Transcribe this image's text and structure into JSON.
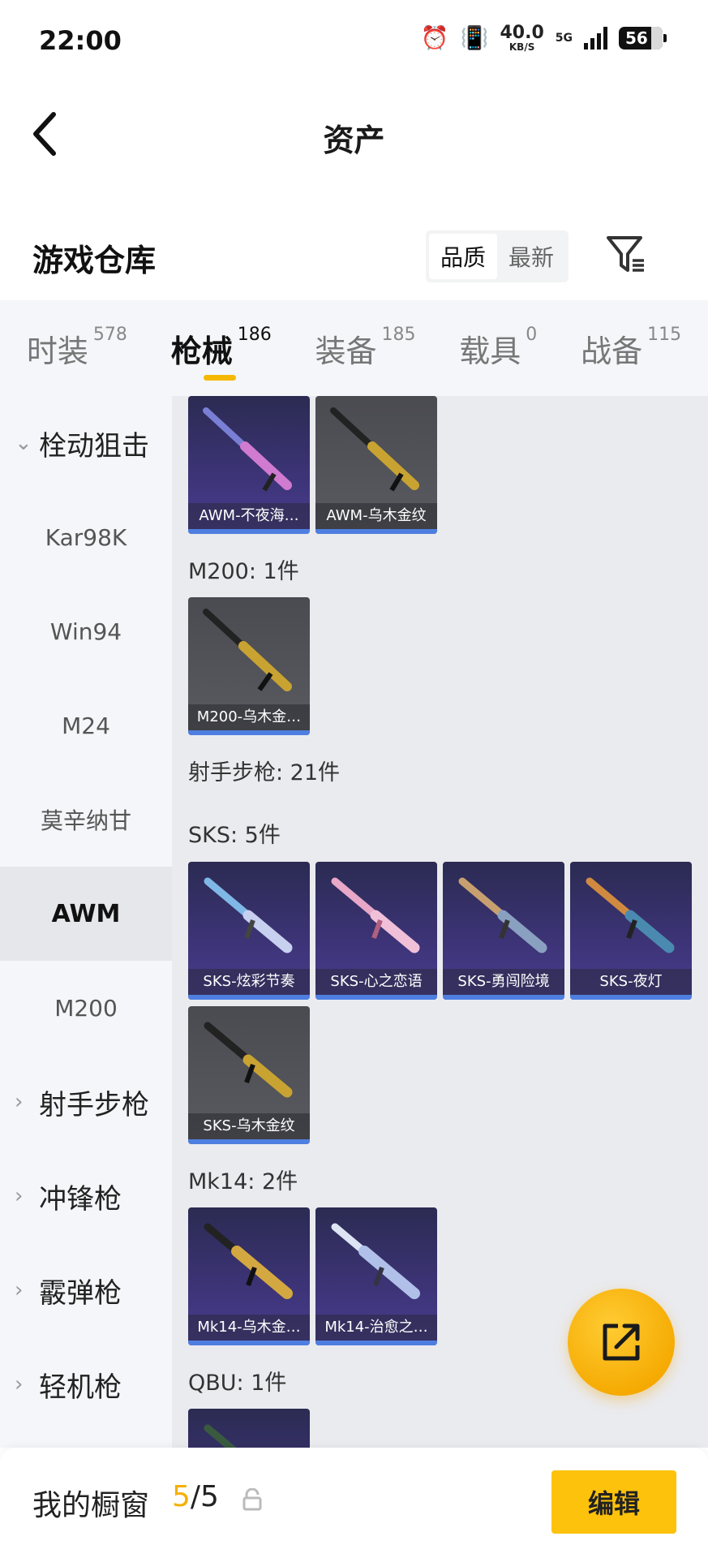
{
  "status_bar": {
    "time": "22:00",
    "speed_value": "40.0",
    "speed_unit": "KB/S",
    "network": "5G",
    "battery": "56"
  },
  "header": {
    "title": "资产",
    "back_icon": "chevron-left-icon"
  },
  "warehouse": {
    "title": "游戏仓库",
    "sort_options": [
      "品质",
      "最新"
    ],
    "active_sort": "品质",
    "filter_icon": "filter-icon"
  },
  "tabs": [
    {
      "label": "时装",
      "count": "578"
    },
    {
      "label": "枪械",
      "count": "186",
      "active": true
    },
    {
      "label": "装备",
      "count": "185"
    },
    {
      "label": "载具",
      "count": "0"
    },
    {
      "label": "战备",
      "count": "115"
    }
  ],
  "sidebar": {
    "items": [
      {
        "label": "栓动狙击",
        "type": "group",
        "expanded": true
      },
      {
        "label": "Kar98K",
        "type": "sub"
      },
      {
        "label": "Win94",
        "type": "sub"
      },
      {
        "label": "M24",
        "type": "sub"
      },
      {
        "label": "莫辛纳甘",
        "type": "sub"
      },
      {
        "label": "AWM",
        "type": "sub",
        "active": true
      },
      {
        "label": "M200",
        "type": "sub"
      },
      {
        "label": "射手步枪",
        "type": "group"
      },
      {
        "label": "冲锋枪",
        "type": "group"
      },
      {
        "label": "霰弹枪",
        "type": "group"
      },
      {
        "label": "轻机枪",
        "type": "group"
      }
    ]
  },
  "content": {
    "sections": [
      {
        "label": ""
      },
      {
        "label": "M200: 1件"
      },
      {
        "label": "射手步枪: 21件"
      },
      {
        "label": "SKS: 5件"
      },
      {
        "label": "Mk14: 2件"
      },
      {
        "label": "QBU: 1件"
      }
    ],
    "items": [
      {
        "name": "AWM-不夜海…",
        "style": "purple"
      },
      {
        "name": "AWM-乌木金纹",
        "style": "gray"
      },
      {
        "name": "M200-乌木金…",
        "style": "gray"
      },
      {
        "name": "SKS-炫彩节奏",
        "style": "purple"
      },
      {
        "name": "SKS-心之恋语",
        "style": "purple"
      },
      {
        "name": "SKS-勇闯险境",
        "style": "purple"
      },
      {
        "name": "SKS-夜灯",
        "style": "purple"
      },
      {
        "name": "SKS-乌木金纹",
        "style": "gray"
      },
      {
        "name": "Mk14-乌木金…",
        "style": "purple"
      },
      {
        "name": "Mk14-治愈之…",
        "style": "purple"
      },
      {
        "name": "",
        "style": "purple"
      }
    ]
  },
  "fab": {
    "icon": "share-icon"
  },
  "bottom_bar": {
    "label": "我的橱窗",
    "current": "5",
    "separator": "/",
    "total": "5",
    "edit_label": "编辑"
  }
}
